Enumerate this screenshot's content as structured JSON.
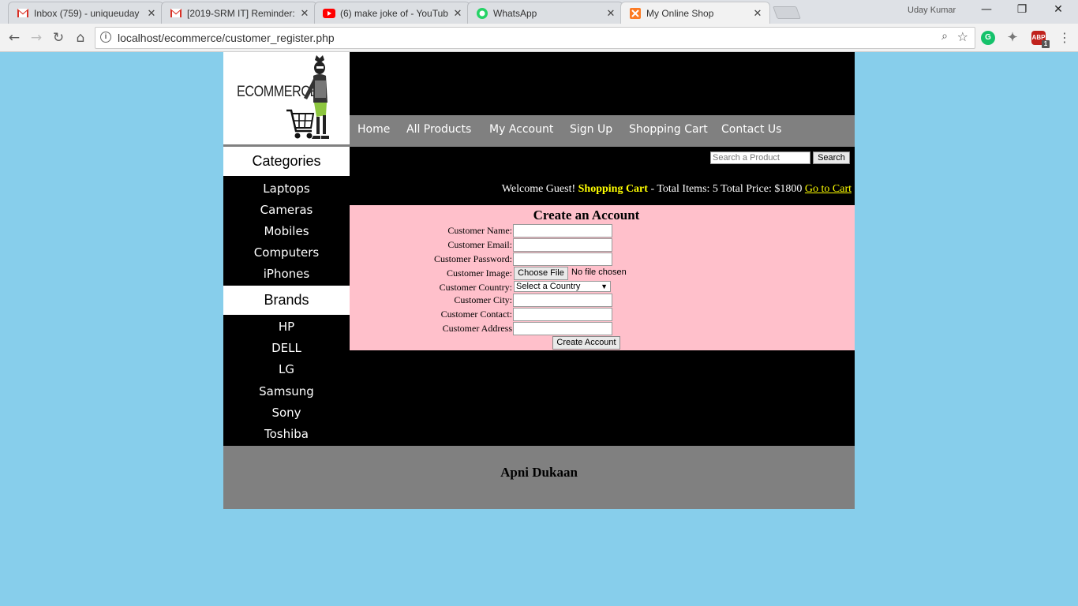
{
  "browser": {
    "tabs": [
      {
        "title": "Inbox (759) - uniqueuday",
        "icon": "gmail-icon"
      },
      {
        "title": "[2019-SRM IT] Reminder:",
        "icon": "gmail-icon"
      },
      {
        "title": "(6) make joke of - YouTub",
        "icon": "youtube-icon"
      },
      {
        "title": "WhatsApp",
        "icon": "whatsapp-icon"
      },
      {
        "title": "My Online Shop",
        "icon": "xampp-icon"
      }
    ],
    "profile_name": "Uday Kumar",
    "url": "localhost/ecommerce/customer_register.php",
    "extension_badge": "1"
  },
  "site": {
    "logo_text": "ECOMMERCE",
    "menu": [
      "Home",
      "All Products",
      "My Account",
      "Sign Up",
      "Shopping Cart",
      "Contact Us"
    ],
    "categories_title": "Categories",
    "categories": [
      "Laptops",
      "Cameras",
      "Mobiles",
      "Computers",
      "iPhones"
    ],
    "brands_title": "Brands",
    "brands": [
      "HP",
      "DELL",
      "LG",
      "Samsung",
      "Sony",
      "Toshiba"
    ],
    "search": {
      "placeholder": "Search a Product",
      "button": "Search"
    },
    "welcome": {
      "greeting": "Welcome Guest!",
      "cart_label": "Shopping Cart",
      "totals": "- Total Items: 5 Total Price: $1800",
      "go_to_cart": "Go to Cart"
    },
    "form": {
      "title": "Create an Account",
      "labels": {
        "name": "Customer Name:",
        "email": "Customer Email:",
        "password": "Customer Password:",
        "image": "Customer Image:",
        "country": "Customer Country:",
        "city": "Customer City:",
        "contact": "Customer Contact:",
        "address": "Customer Address"
      },
      "file_button": "Choose File",
      "file_status": "No file chosen",
      "country_selected": "Select a Country",
      "submit": "Create Account"
    },
    "footer_text": "Apni Dukaan"
  }
}
